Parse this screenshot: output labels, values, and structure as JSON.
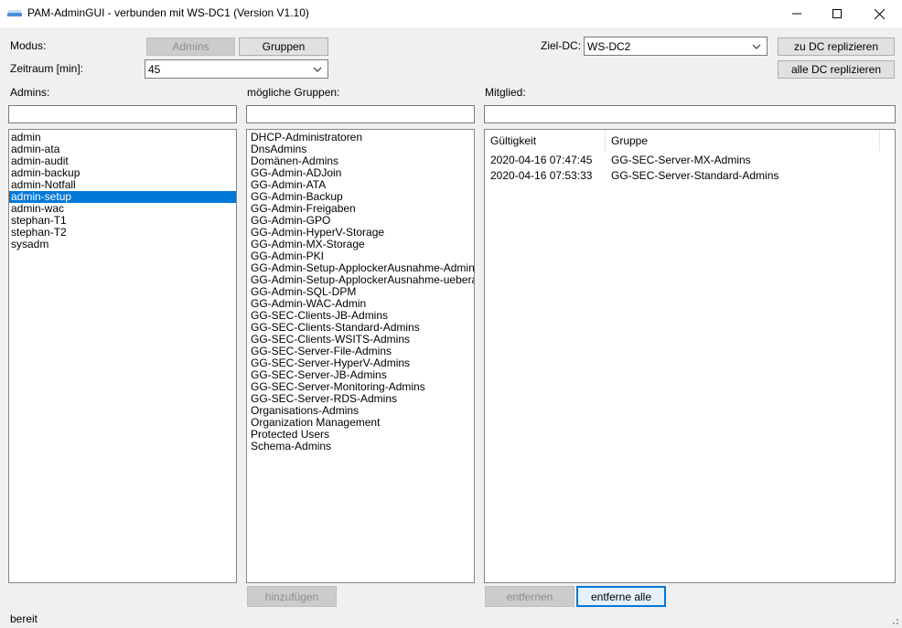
{
  "window": {
    "title": "PAM-AdminGUI - verbunden mit WS-DC1 (Version V1.10)",
    "minimize": "–",
    "maximize": "☐",
    "close": "✕"
  },
  "mode": {
    "label": "Modus:",
    "admins_button": "Admins",
    "groups_button": "Gruppen"
  },
  "timeframe": {
    "label": "Zeitraum [min]:",
    "value": "45"
  },
  "target_dc": {
    "label": "Ziel-DC:",
    "value": "WS-DC2",
    "replicate_dc_button": "zu DC replizieren",
    "replicate_all_button": "alle DC replizieren"
  },
  "admins": {
    "label": "Admins:",
    "filter": "",
    "items": [
      "admin",
      "admin-ata",
      "admin-audit",
      "admin-backup",
      "admin-Notfall",
      "admin-setup",
      "admin-wac",
      "stephan-T1",
      "stephan-T2",
      "sysadm"
    ],
    "selected": "admin-setup"
  },
  "groups": {
    "label": "mögliche Gruppen:",
    "filter": "",
    "items": [
      "DHCP-Administratoren",
      "DnsAdmins",
      "Domänen-Admins",
      "GG-Admin-ADJoin",
      "GG-Admin-ATA",
      "GG-Admin-Backup",
      "GG-Admin-Freigaben",
      "GG-Admin-GPO",
      "GG-Admin-HyperV-Storage",
      "GG-Admin-MX-Storage",
      "GG-Admin-PKI",
      "GG-Admin-Setup-ApplockerAusnahme-AdminDir",
      "GG-Admin-Setup-ApplockerAusnahme-ueberall",
      "GG-Admin-SQL-DPM",
      "GG-Admin-WAC-Admin",
      "GG-SEC-Clients-JB-Admins",
      "GG-SEC-Clients-Standard-Admins",
      "GG-SEC-Clients-WSITS-Admins",
      "GG-SEC-Server-File-Admins",
      "GG-SEC-Server-HyperV-Admins",
      "GG-SEC-Server-JB-Admins",
      "GG-SEC-Server-Monitoring-Admins",
      "GG-SEC-Server-RDS-Admins",
      "Organisations-Admins",
      "Organization Management",
      "Protected Users",
      "Schema-Admins"
    ],
    "add_button": "hinzufügen"
  },
  "member": {
    "label": "Mitglied:",
    "filter": "",
    "columns": [
      "Gültigkeit",
      "Gruppe"
    ],
    "rows": [
      [
        "2020-04-16 07:47:45",
        "GG-SEC-Server-MX-Admins"
      ],
      [
        "2020-04-16 07:53:33",
        "GG-SEC-Server-Standard-Admins"
      ]
    ],
    "remove_button": "entfernen",
    "remove_all_button": "entferne alle"
  },
  "status": {
    "text": "bereit"
  }
}
